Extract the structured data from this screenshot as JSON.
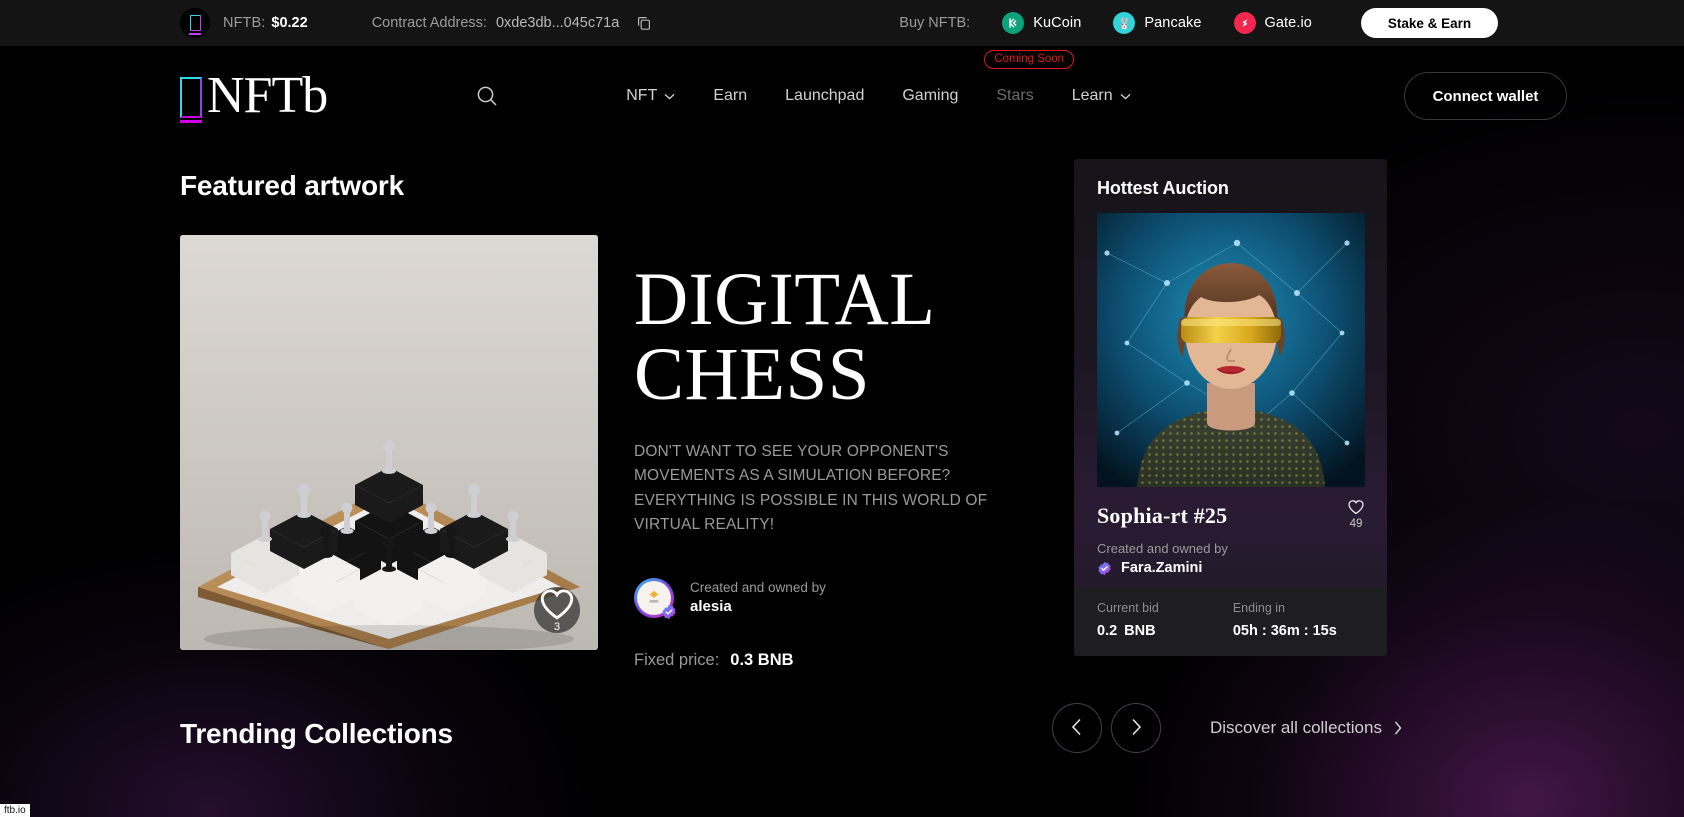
{
  "topbar": {
    "token_label": "NFTB:",
    "token_price": "$0.22",
    "contract_label": "Contract Address:",
    "contract_value": "0xde3db...045c71a",
    "copy_icon": "copy-icon",
    "buy_label": "Buy NFTB:",
    "exchanges": [
      {
        "name": "KuCoin",
        "glyph": "K",
        "color": "#0ba17d"
      },
      {
        "name": "Pancake",
        "glyph": "🐰",
        "color": "#30d4d9"
      },
      {
        "name": "Gate.io",
        "glyph": "G",
        "color": "#f2264e"
      }
    ],
    "stake_button": "Stake & Earn"
  },
  "nav": {
    "brand": "NFTb",
    "search_icon": "search-icon",
    "items": [
      {
        "label": "NFT",
        "has_caret": true,
        "dim": false,
        "badge": null
      },
      {
        "label": "Earn",
        "has_caret": false,
        "dim": false,
        "badge": null
      },
      {
        "label": "Launchpad",
        "has_caret": false,
        "dim": false,
        "badge": null
      },
      {
        "label": "Gaming",
        "has_caret": false,
        "dim": false,
        "badge": null
      },
      {
        "label": "Stars",
        "has_caret": false,
        "dim": true,
        "badge": "Coming Soon"
      },
      {
        "label": "Learn",
        "has_caret": true,
        "dim": false,
        "badge": null
      }
    ],
    "connect_button": "Connect wallet"
  },
  "featured": {
    "section_title": "Featured artwork",
    "image_alt": "digital-chess-artwork",
    "likes": "3",
    "title_line1": "DIGITAL",
    "title_line2": "CHESS",
    "description": "DON'T WANT TO SEE YOUR OPPONENT'S MOVEMENTS AS A SIMULATION BEFORE? EVERYTHING IS POSSIBLE IN THIS WORLD OF VIRTUAL REALITY!",
    "created_label": "Created and owned by",
    "creator": "alesia",
    "price_label": "Fixed price:",
    "price_value": "0.3 BNB"
  },
  "auction": {
    "heading": "Hottest Auction",
    "image_alt": "sophia-rt-avatar-artwork",
    "title": "Sophia-rt #25",
    "likes": "49",
    "created_label": "Created and owned by",
    "creator": "Fara.Zamini",
    "bid_label": "Current bid",
    "bid_value": "0.2",
    "bid_unit": "BNB",
    "ending_label": "Ending in",
    "ending_value": "05h : 36m : 15s"
  },
  "trending": {
    "section_title": "Trending Collections",
    "prev_icon": "chevron-left-icon",
    "next_icon": "chevron-right-icon",
    "discover_label": "Discover all collections",
    "discover_icon": "chevron-right-icon"
  },
  "status_tag": "ftb.io",
  "colors": {
    "accent_cyan": "#2fd9e8",
    "accent_magenta": "#d000e8",
    "coming_soon": "#e01b1b",
    "topbar_bg": "#141414"
  }
}
